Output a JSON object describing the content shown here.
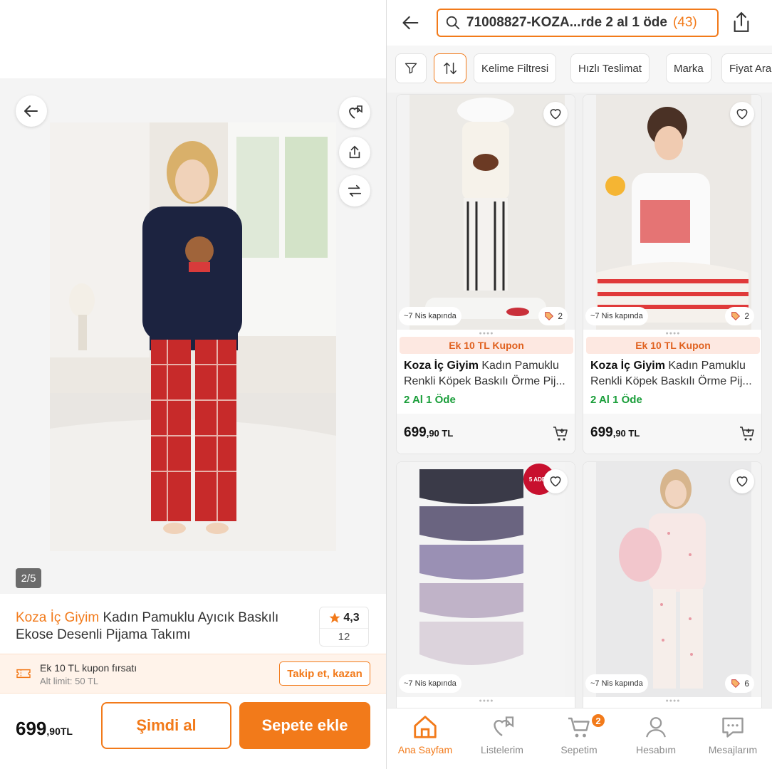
{
  "left": {
    "gallery_counter": "2/5",
    "product": {
      "brand": "Koza İç Giyim",
      "name": " Kadın Pamuklu Ayıcık Baskılı Ekose Desenli Pijama Takımı",
      "rating": "4,3",
      "review_count": "12"
    },
    "coupon": {
      "title": "Ek 10 TL kupon fırsatı",
      "subtitle": "Alt limit: 50 TL",
      "button": "Takip et, kazan"
    },
    "price": {
      "main": "699",
      "decimals": ",90TL"
    },
    "buy_now": "Şimdi al",
    "add_to_cart": "Sepete ekle"
  },
  "right": {
    "search_text": "71008827-KOZA...rde 2 al 1 öde",
    "search_count": "(43)",
    "filters": [
      "Kelime Filtresi",
      "Hızlı Teslimat",
      "Marka",
      "Fiyat Ara"
    ],
    "products": [
      {
        "ship": "~7 Nis kapında",
        "colors": "2",
        "coupon": "Ek 10 TL Kupon",
        "brand": "Koza İç Giyim",
        "name": " Kadın Pamuklu Renkli Köpek Baskılı Örme Pij...",
        "promo": "2 Al 1 Öde",
        "price": "699",
        "price_dec": ",90 TL"
      },
      {
        "ship": "~7 Nis kapında",
        "colors": "2",
        "coupon": "Ek 10 TL Kupon",
        "brand": "Koza İç Giyim",
        "name": " Kadın Pamuklu Renkli Köpek Baskılı Örme Pij...",
        "promo": "2 Al 1 Öde",
        "price": "699",
        "price_dec": ",90 TL"
      },
      {
        "ship": "~7 Nis kapında",
        "badge": "5 ADET"
      },
      {
        "ship": "~7 Nis kapında",
        "colors": "6"
      }
    ],
    "tabs": [
      {
        "label": "Ana Sayfam"
      },
      {
        "label": "Listelerim"
      },
      {
        "label": "Sepetim",
        "badge": "2"
      },
      {
        "label": "Hesabım"
      },
      {
        "label": "Mesajlarım"
      }
    ]
  },
  "colors": {
    "accent": "#f27a1a",
    "promo_green": "#1a9e3a"
  }
}
